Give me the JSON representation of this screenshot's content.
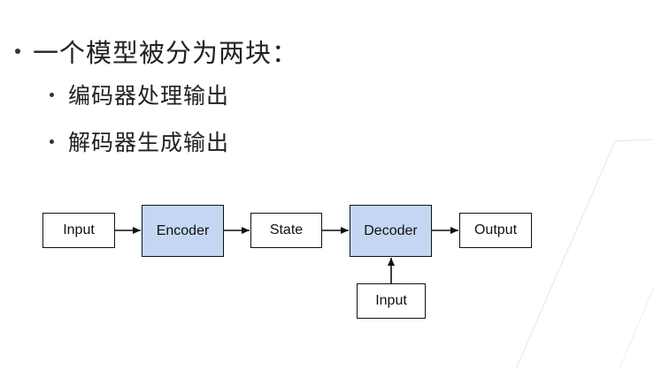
{
  "slide": {
    "bullets": {
      "main": "一个模型被分为两块：",
      "sub": [
        "编码器处理输出",
        "解码器生成输出"
      ]
    }
  },
  "diagram": {
    "nodes": {
      "input1": "Input",
      "encoder": "Encoder",
      "state": "State",
      "decoder": "Decoder",
      "output": "Output",
      "input2": "Input"
    },
    "highlight_color": "#c3d7f3",
    "edges": [
      [
        "input1",
        "encoder"
      ],
      [
        "encoder",
        "state"
      ],
      [
        "state",
        "decoder"
      ],
      [
        "decoder",
        "output"
      ],
      [
        "input2",
        "decoder"
      ]
    ]
  }
}
